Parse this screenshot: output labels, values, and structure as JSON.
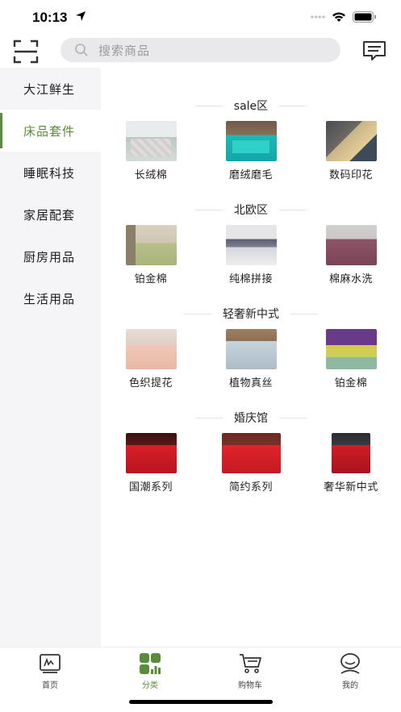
{
  "status": {
    "time": "10:13"
  },
  "search": {
    "placeholder": "搜索商品"
  },
  "sidebar": {
    "items": [
      {
        "label": "大江鲜生",
        "active": false
      },
      {
        "label": "床品套件",
        "active": true
      },
      {
        "label": "睡眠科技",
        "active": false
      },
      {
        "label": "家居配套",
        "active": false
      },
      {
        "label": "厨房用品",
        "active": false
      },
      {
        "label": "生活用品",
        "active": false
      }
    ]
  },
  "sections": [
    {
      "title": "sale区",
      "products": [
        "长绒棉",
        "磨绒磨毛",
        "数码印花"
      ]
    },
    {
      "title": "北欧区",
      "products": [
        "铂金棉",
        "纯棉拼接",
        "棉麻水洗"
      ]
    },
    {
      "title": "轻奢新中式",
      "products": [
        "色织提花",
        "植物真丝",
        "铂金棉"
      ]
    },
    {
      "title": "婚庆馆",
      "products": [
        "国潮系列",
        "简约系列",
        "奢华新中式"
      ]
    }
  ],
  "tabbar": {
    "items": [
      {
        "label": "首页",
        "icon": "home-chart-icon",
        "active": false
      },
      {
        "label": "分类",
        "icon": "category-grid-icon",
        "active": true
      },
      {
        "label": "购物车",
        "icon": "cart-icon",
        "active": false
      },
      {
        "label": "我的",
        "icon": "profile-icon",
        "active": false
      }
    ]
  },
  "colors": {
    "accent": "#5b8c3a",
    "sidebar_bg": "#f5f5f7",
    "search_bg": "#e9e9ec"
  }
}
